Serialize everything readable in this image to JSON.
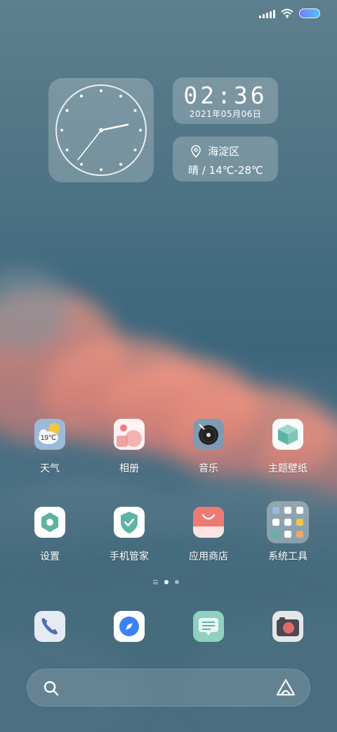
{
  "status_bar": {
    "signal_icon": "signal-bars-icon",
    "wifi_icon": "wifi-icon",
    "battery_icon": "battery-icon",
    "battery_colors": [
      "#7b7bff",
      "#47c7ff"
    ]
  },
  "clock_widget": {
    "icon": "analog-clock-icon",
    "time": "02:36"
  },
  "time_widget": {
    "time": "02:36",
    "date": "2021年05月06日"
  },
  "weather_widget": {
    "location_icon": "location-pin-icon",
    "location": "海淀区",
    "condition_temp": "晴 / 14℃-28℃"
  },
  "apps": [
    {
      "label": "天气",
      "icon": "weather-icon",
      "badge": "19℃"
    },
    {
      "label": "相册",
      "icon": "gallery-icon"
    },
    {
      "label": "音乐",
      "icon": "music-icon"
    },
    {
      "label": "主题壁纸",
      "icon": "themes-icon"
    },
    {
      "label": "设置",
      "icon": "settings-icon"
    },
    {
      "label": "手机管家",
      "icon": "security-icon"
    },
    {
      "label": "应用商店",
      "icon": "app-store-icon"
    },
    {
      "label": "系统工具",
      "icon": "folder-icon"
    }
  ],
  "page_indicator": {
    "pages": 2,
    "current": 1
  },
  "dock": [
    {
      "icon": "phone-icon"
    },
    {
      "icon": "browser-icon"
    },
    {
      "icon": "messages-icon"
    },
    {
      "icon": "camera-icon"
    }
  ],
  "search": {
    "icon": "search-icon",
    "assistant_icon": "assistant-icon"
  },
  "colors": {
    "sky": "#4e7384",
    "cloud_pink": "#f0907f",
    "weather_icon_bg": "#9bb9d9",
    "settings_green": "#5fb3a3",
    "store_red": "#ef7a72",
    "browser_blue": "#3b82f6",
    "camera_red": "#e26a6a"
  }
}
